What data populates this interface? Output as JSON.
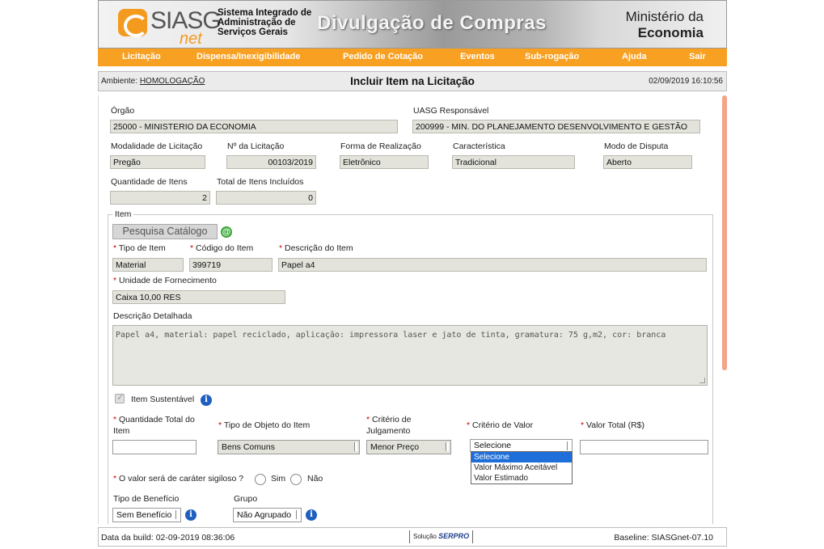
{
  "banner": {
    "logo_text": "SIASG",
    "logo_net": "net",
    "system_name": "Sistema Integrado de Administração de Serviços Gerais",
    "title": "Divulgação de Compras",
    "ministry_line1": "Ministério da",
    "ministry_line2": "Economia"
  },
  "nav": {
    "items": [
      "Licitação",
      "Dispensa/Inexigibilidade",
      "Pedido de Cotação",
      "Eventos",
      "Sub-rogação",
      "Ajuda",
      "Sair"
    ]
  },
  "titlebar": {
    "ambiente_label": "Ambiente:",
    "ambiente_value": "HOMOLOGAÇÃO",
    "page_title": "Incluir Item na Licitação",
    "datetime": "02/09/2019 16:10:56"
  },
  "form": {
    "orgao": {
      "label": "Órgão",
      "value": "25000 - MINISTERIO DA ECONOMIA"
    },
    "uasg": {
      "label": "UASG Responsável",
      "value": "200999 - MIN. DO PLANEJAMENTO DESENVOLVIMENTO E GESTÃO"
    },
    "modalidade": {
      "label": "Modalidade de Licitação",
      "value": "Pregão"
    },
    "numero": {
      "label": "Nº da Licitação",
      "value": "00103/2019"
    },
    "forma": {
      "label": "Forma de Realização",
      "value": "Eletrônico"
    },
    "caracteristica": {
      "label": "Característica",
      "value": "Tradicional"
    },
    "modo_disputa": {
      "label": "Modo de Disputa",
      "value": "Aberto"
    },
    "qtd_itens": {
      "label": "Quantidade de Itens",
      "value": "2"
    },
    "total_itens": {
      "label": "Total de Itens Incluídos",
      "value": "0"
    }
  },
  "item": {
    "legend": "Item",
    "catalog_button": "Pesquisa Catálogo",
    "tipo_item": {
      "label": "Tipo de Item",
      "value": "Material"
    },
    "codigo_item": {
      "label": "Código do Item",
      "value": "399719"
    },
    "descricao_item": {
      "label": "Descrição do Item",
      "value": "Papel a4"
    },
    "unidade": {
      "label": "Unidade de Fornecimento",
      "value": "Caixa 10,00 RES"
    },
    "descricao_detalhada": {
      "label": "Descrição Detalhada",
      "value": "Papel a4, material: papel reciclado, aplicação: impressora laser e jato de tinta, gramatura: 75 g,m2, cor: branca"
    },
    "sustentavel": {
      "label": "Item Sustentável"
    },
    "quantidade_total": {
      "label_1": "Quantidade Total do",
      "label_2": "Item",
      "value": ""
    },
    "tipo_objeto": {
      "label": "Tipo de Objeto do Item",
      "value": "Bens Comuns"
    },
    "criterio_julgamento": {
      "label_1": "Critério de",
      "label_2": "Julgamento",
      "value": "Menor Preço"
    },
    "criterio_valor": {
      "label": "Critério de Valor",
      "value": "Selecione",
      "options": [
        "Selecione",
        "Valor Máximo Aceitável",
        "Valor Estimado"
      ]
    },
    "valor_total": {
      "label": "Valor Total (R$)",
      "value": ""
    },
    "sigiloso": {
      "label": "O valor será de caráter sigiloso ?",
      "sim": "Sim",
      "nao": "Não"
    },
    "tipo_beneficio": {
      "label": "Tipo de Benefício",
      "value": "Sem Benefício"
    },
    "grupo": {
      "label": "Grupo",
      "value": "Não Agrupado"
    }
  },
  "footer": {
    "build": "Data da build: 02-09-2019 08:36:06",
    "solucao": "Solução",
    "serpro": "SERPRO",
    "baseline": "Baseline: SIASGnet-07.10"
  }
}
